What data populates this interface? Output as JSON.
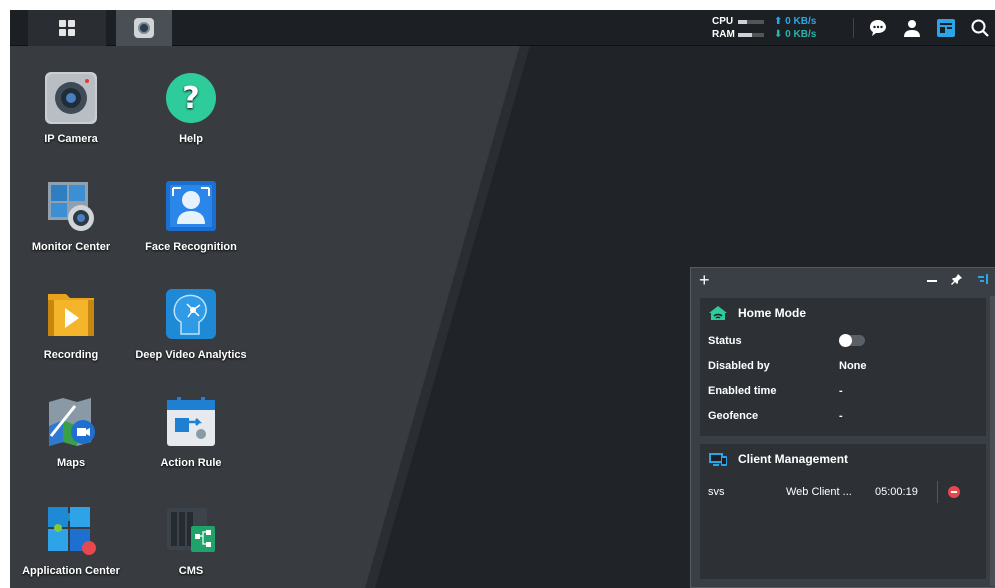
{
  "taskbar": {
    "cpu_label": "CPU",
    "ram_label": "RAM",
    "upload": "0 KB/s",
    "download": "0 KB/s",
    "cpu_level": 0.35,
    "ram_level": 0.55
  },
  "desktop_icons": [
    {
      "label": "IP Camera"
    },
    {
      "label": "Help"
    },
    {
      "label": "Monitor Center"
    },
    {
      "label": "Face Recognition"
    },
    {
      "label": "Recording"
    },
    {
      "label": "Deep Video Analytics"
    },
    {
      "label": "Maps"
    },
    {
      "label": "Action Rule"
    },
    {
      "label": "Application Center"
    },
    {
      "label": "CMS"
    }
  ],
  "widget": {
    "home_mode": {
      "title": "Home Mode",
      "status_label": "Status",
      "disabled_by_label": "Disabled by",
      "disabled_by_value": "None",
      "enabled_time_label": "Enabled time",
      "enabled_time_value": "-",
      "geofence_label": "Geofence",
      "geofence_value": "-"
    },
    "client_management": {
      "title": "Client Management",
      "rows": [
        {
          "user": "svs",
          "client": "Web Client ...",
          "duration": "05:00:19"
        }
      ]
    }
  },
  "colors": {
    "accent_blue": "#2aa6e8",
    "help_green": "#2ecc9a",
    "remove_red": "#e5484d"
  }
}
